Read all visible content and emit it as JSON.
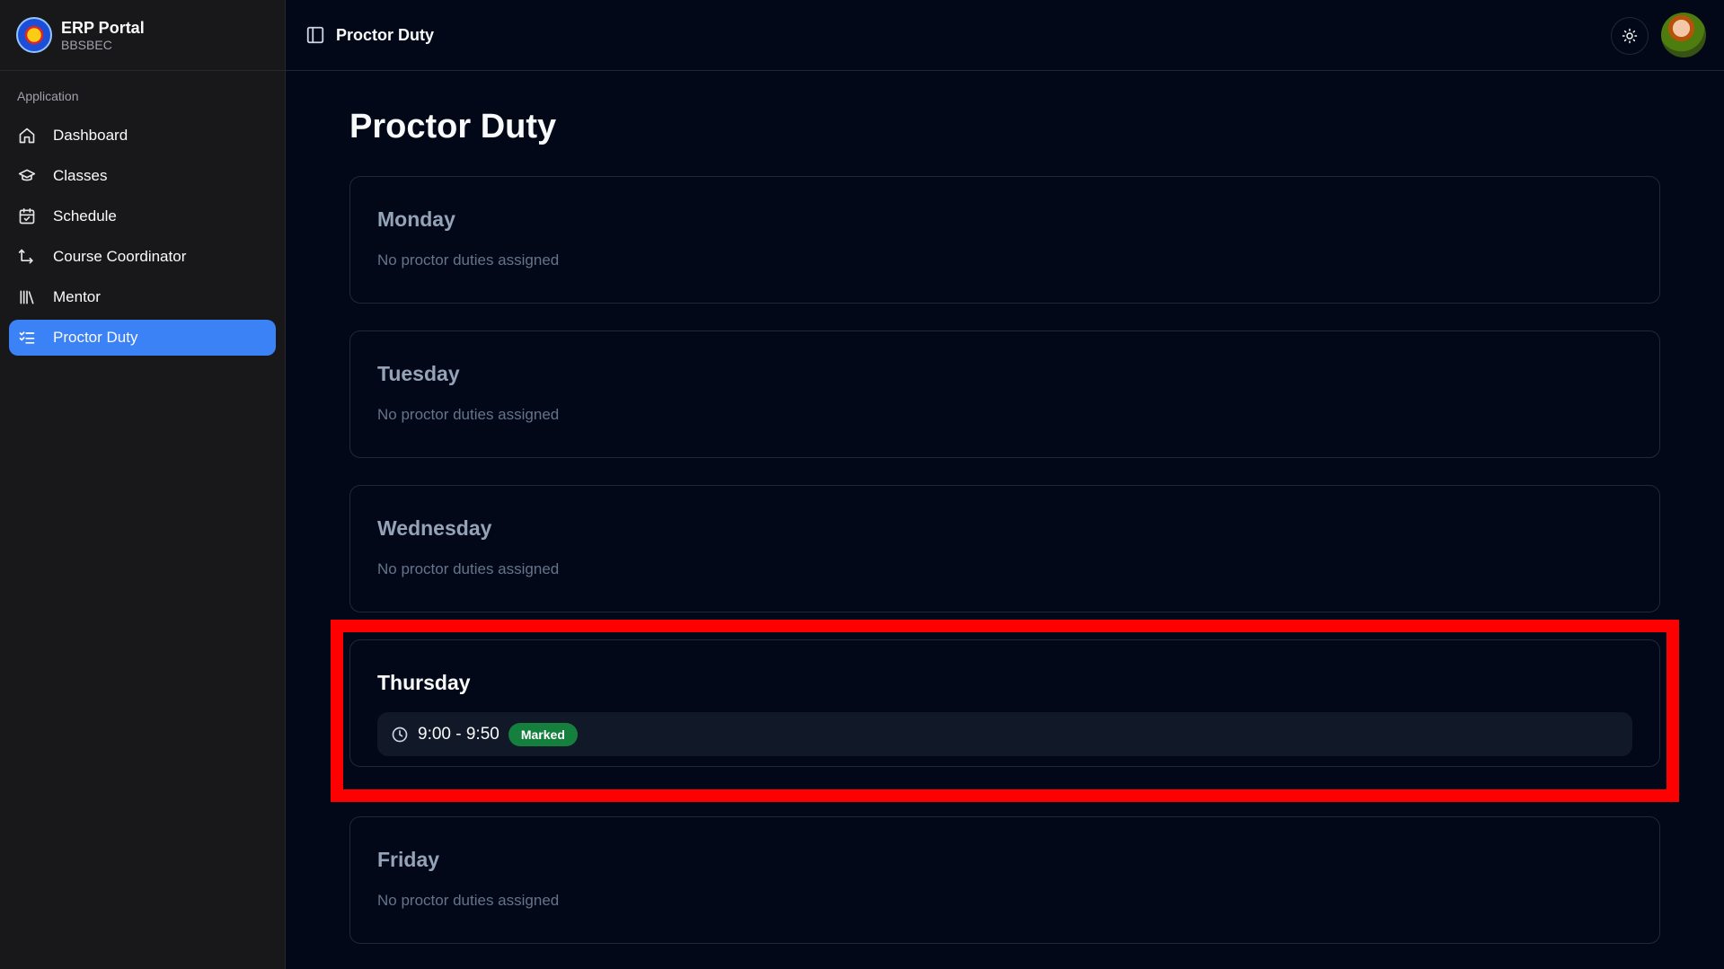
{
  "brand": {
    "title": "ERP Portal",
    "subtitle": "BBSBEC"
  },
  "sidebar": {
    "group_label": "Application",
    "items": [
      {
        "label": "Dashboard",
        "icon": "home-icon"
      },
      {
        "label": "Classes",
        "icon": "graduation-cap-icon"
      },
      {
        "label": "Schedule",
        "icon": "calendar-check-icon"
      },
      {
        "label": "Course Coordinator",
        "icon": "route-icon"
      },
      {
        "label": "Mentor",
        "icon": "library-icon"
      },
      {
        "label": "Proctor Duty",
        "icon": "list-checks-icon",
        "active": true
      }
    ]
  },
  "header": {
    "title": "Proctor Duty",
    "theme_toggle_icon": "sun-icon"
  },
  "main": {
    "title": "Proctor Duty",
    "days": [
      {
        "name": "Monday",
        "empty_text": "No proctor duties assigned"
      },
      {
        "name": "Tuesday",
        "empty_text": "No proctor duties assigned"
      },
      {
        "name": "Wednesday",
        "empty_text": "No proctor duties assigned"
      },
      {
        "name": "Thursday",
        "duty": {
          "time": "9:00 - 9:50",
          "status": "Marked"
        }
      },
      {
        "name": "Friday",
        "empty_text": "No proctor duties assigned"
      }
    ]
  },
  "colors": {
    "accent": "#3b82f6",
    "badge_marked": "#15803d",
    "highlight": "#ff0000",
    "background": "#020817"
  }
}
